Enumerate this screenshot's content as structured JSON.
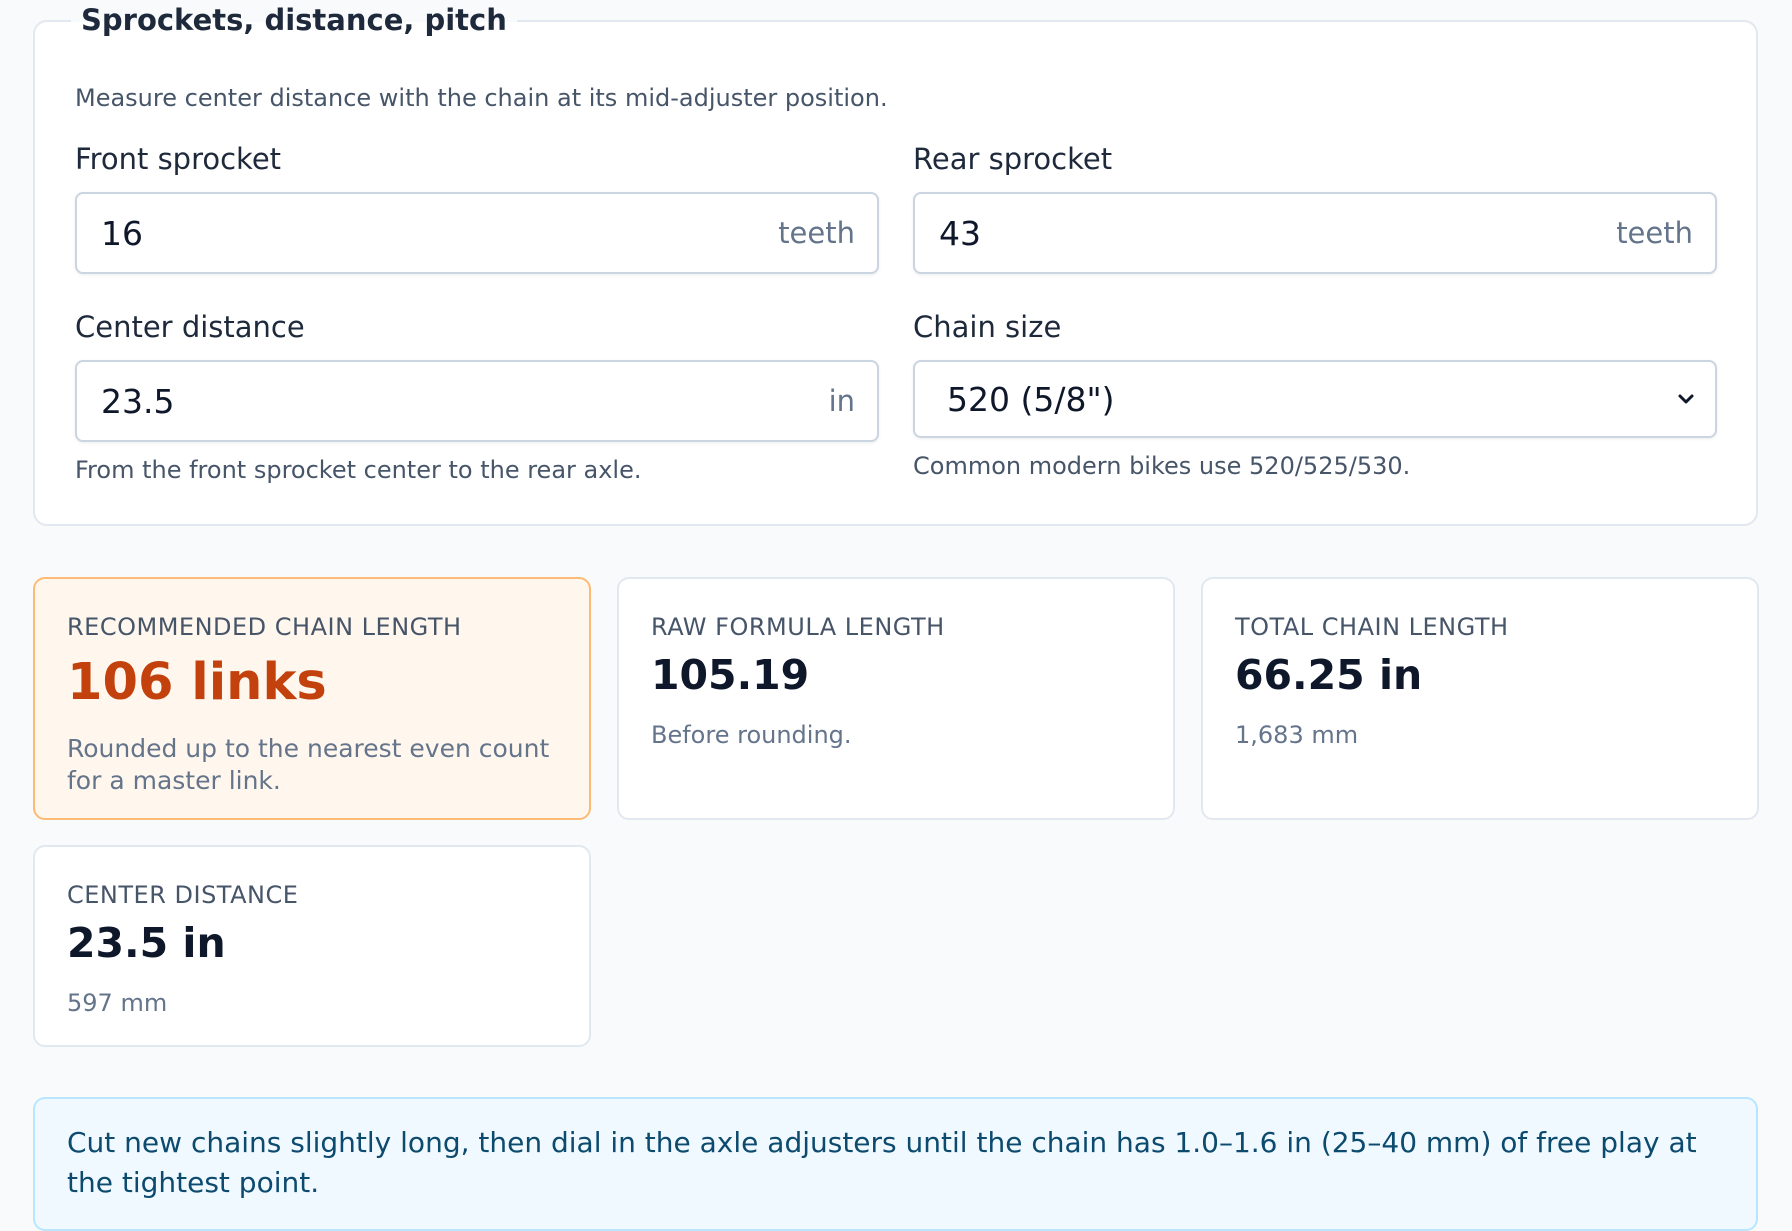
{
  "form": {
    "legend": "Sprockets, distance, pitch",
    "hint": "Measure center distance with the chain at its mid-adjuster position.",
    "front_sprocket": {
      "label": "Front sprocket",
      "value": "16",
      "unit": "teeth"
    },
    "rear_sprocket": {
      "label": "Rear sprocket",
      "value": "43",
      "unit": "teeth"
    },
    "center_distance": {
      "label": "Center distance",
      "value": "23.5",
      "unit": "in",
      "help": "From the front sprocket center to the rear axle."
    },
    "chain_size": {
      "label": "Chain size",
      "selected": "520 (5/8\")",
      "help": "Common modern bikes use 520/525/530.",
      "icon": "chevron-down-icon"
    }
  },
  "results": {
    "recommended": {
      "label": "RECOMMENDED CHAIN LENGTH",
      "value": "106 links",
      "sub": "Rounded up to the nearest even count for a master link."
    },
    "raw": {
      "label": "RAW FORMULA LENGTH",
      "value": "105.19",
      "sub": "Before rounding."
    },
    "total": {
      "label": "TOTAL CHAIN LENGTH",
      "value": "66.25 in",
      "sub": "1,683 mm"
    },
    "center": {
      "label": "CENTER DISTANCE",
      "value": "23.5 in",
      "sub": "597 mm"
    }
  },
  "note": {
    "text": "Cut new chains slightly long, then dial in the axle adjusters until the chain has 1.0–1.6 in (25–40 mm) of free play at the tightest point."
  },
  "colors": {
    "accent": "#c2410c",
    "highlight_bg": "#fff7ed",
    "highlight_border": "#fdba74",
    "note_bg": "#f0f9ff",
    "note_border": "#bae6fd"
  }
}
